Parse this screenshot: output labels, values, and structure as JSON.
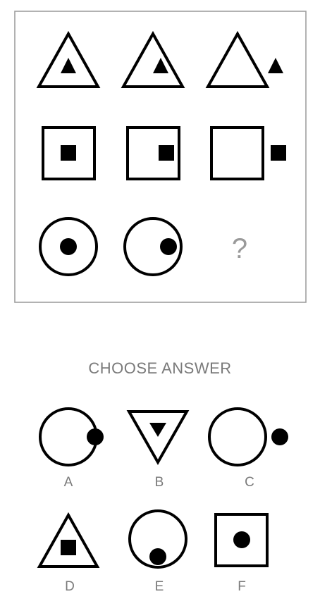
{
  "puzzle": {
    "question_mark": "?"
  },
  "choose_answer_heading": "CHOOSE ANSWER",
  "answers": {
    "a": {
      "label": "A"
    },
    "b": {
      "label": "B"
    },
    "c": {
      "label": "C"
    },
    "d": {
      "label": "D"
    },
    "e": {
      "label": "E"
    },
    "f": {
      "label": "F"
    }
  },
  "colors": {
    "stroke": "#000000",
    "frame": "#9e9e9e",
    "label_text": "#7a7a7a"
  }
}
